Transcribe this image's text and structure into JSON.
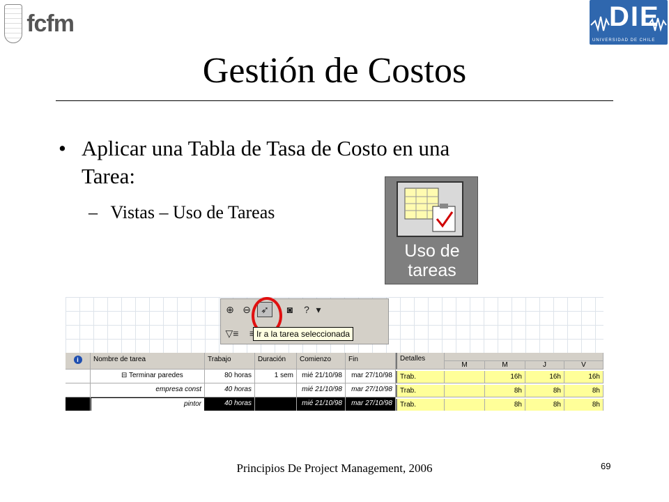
{
  "logos": {
    "left_text": "fcfm",
    "right_text": "DIE",
    "right_subtext": "UNIVERSIDAD DE CHILE"
  },
  "slide": {
    "title": "Gestión de Costos",
    "bullet": "Aplicar una Tabla de Tasa de Costo en una Tarea:",
    "subbullet": "Vistas – Uso de Tareas",
    "bullet_glyph": "•",
    "sub_glyph": "–"
  },
  "view_icon": {
    "label_line1": "Uso de",
    "label_line2": "tareas"
  },
  "toolbar": {
    "tooltip": "Ir a la tarea seleccionada",
    "buttons": [
      "zoom-in-icon",
      "zoom-out-icon",
      "go-to-task-icon",
      "camera-icon",
      "help-icon",
      "filter-icon",
      "outline-icon"
    ]
  },
  "table": {
    "headers": [
      "Nombre de tarea",
      "Trabajo",
      "Duración",
      "Comienzo",
      "Fin"
    ],
    "rows": [
      {
        "name": "⊟ Terminar paredes",
        "trabajo": "80 horas",
        "duracion": "1 sem",
        "comienzo": "mié 21/10/98",
        "fin": "mar 27/10/98"
      },
      {
        "name": "empresa const",
        "trabajo": "40 horas",
        "duracion": "",
        "comienzo": "mié 21/10/98",
        "fin": "mar 27/10/98"
      },
      {
        "name": "pintor",
        "trabajo": "40 horas",
        "duracion": "",
        "comienzo": "mié 21/10/98",
        "fin": "mar 27/10/98"
      }
    ]
  },
  "details": {
    "header": "Detalles",
    "days": [
      "M",
      "M",
      "J",
      "V"
    ],
    "rows": [
      {
        "label": "Trab.",
        "values": [
          "",
          "16h",
          "16h",
          "16h"
        ]
      },
      {
        "label": "Trab.",
        "values": [
          "",
          "8h",
          "8h",
          "8h"
        ]
      },
      {
        "label": "Trab.",
        "values": [
          "",
          "8h",
          "8h",
          "8h"
        ]
      }
    ]
  },
  "footer": {
    "text": "Principios De Project Management, 2006",
    "page": "69"
  }
}
